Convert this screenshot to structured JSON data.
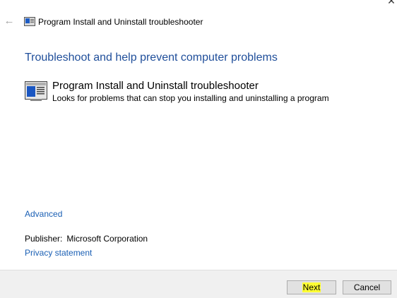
{
  "window": {
    "title": "Program Install and Uninstall troubleshooter",
    "back_icon": "back-arrow-icon",
    "close_icon": "close-icon"
  },
  "main": {
    "heading": "Troubleshoot and help prevent computer problems",
    "troubleshooter": {
      "icon": "troubleshooter-icon",
      "title": "Program Install and Uninstall troubleshooter",
      "description": "Looks for problems that can stop you installing and uninstalling a program"
    },
    "advanced_link": "Advanced",
    "publisher_label": "Publisher:",
    "publisher_value": "Microsoft Corporation",
    "privacy_link": "Privacy statement"
  },
  "footer": {
    "next_label": "Next",
    "cancel_label": "Cancel"
  },
  "colors": {
    "heading": "#1f4e9a",
    "link": "#1a5fb4",
    "footer_bg": "#f0f0f0",
    "highlight": "#ffff33"
  }
}
